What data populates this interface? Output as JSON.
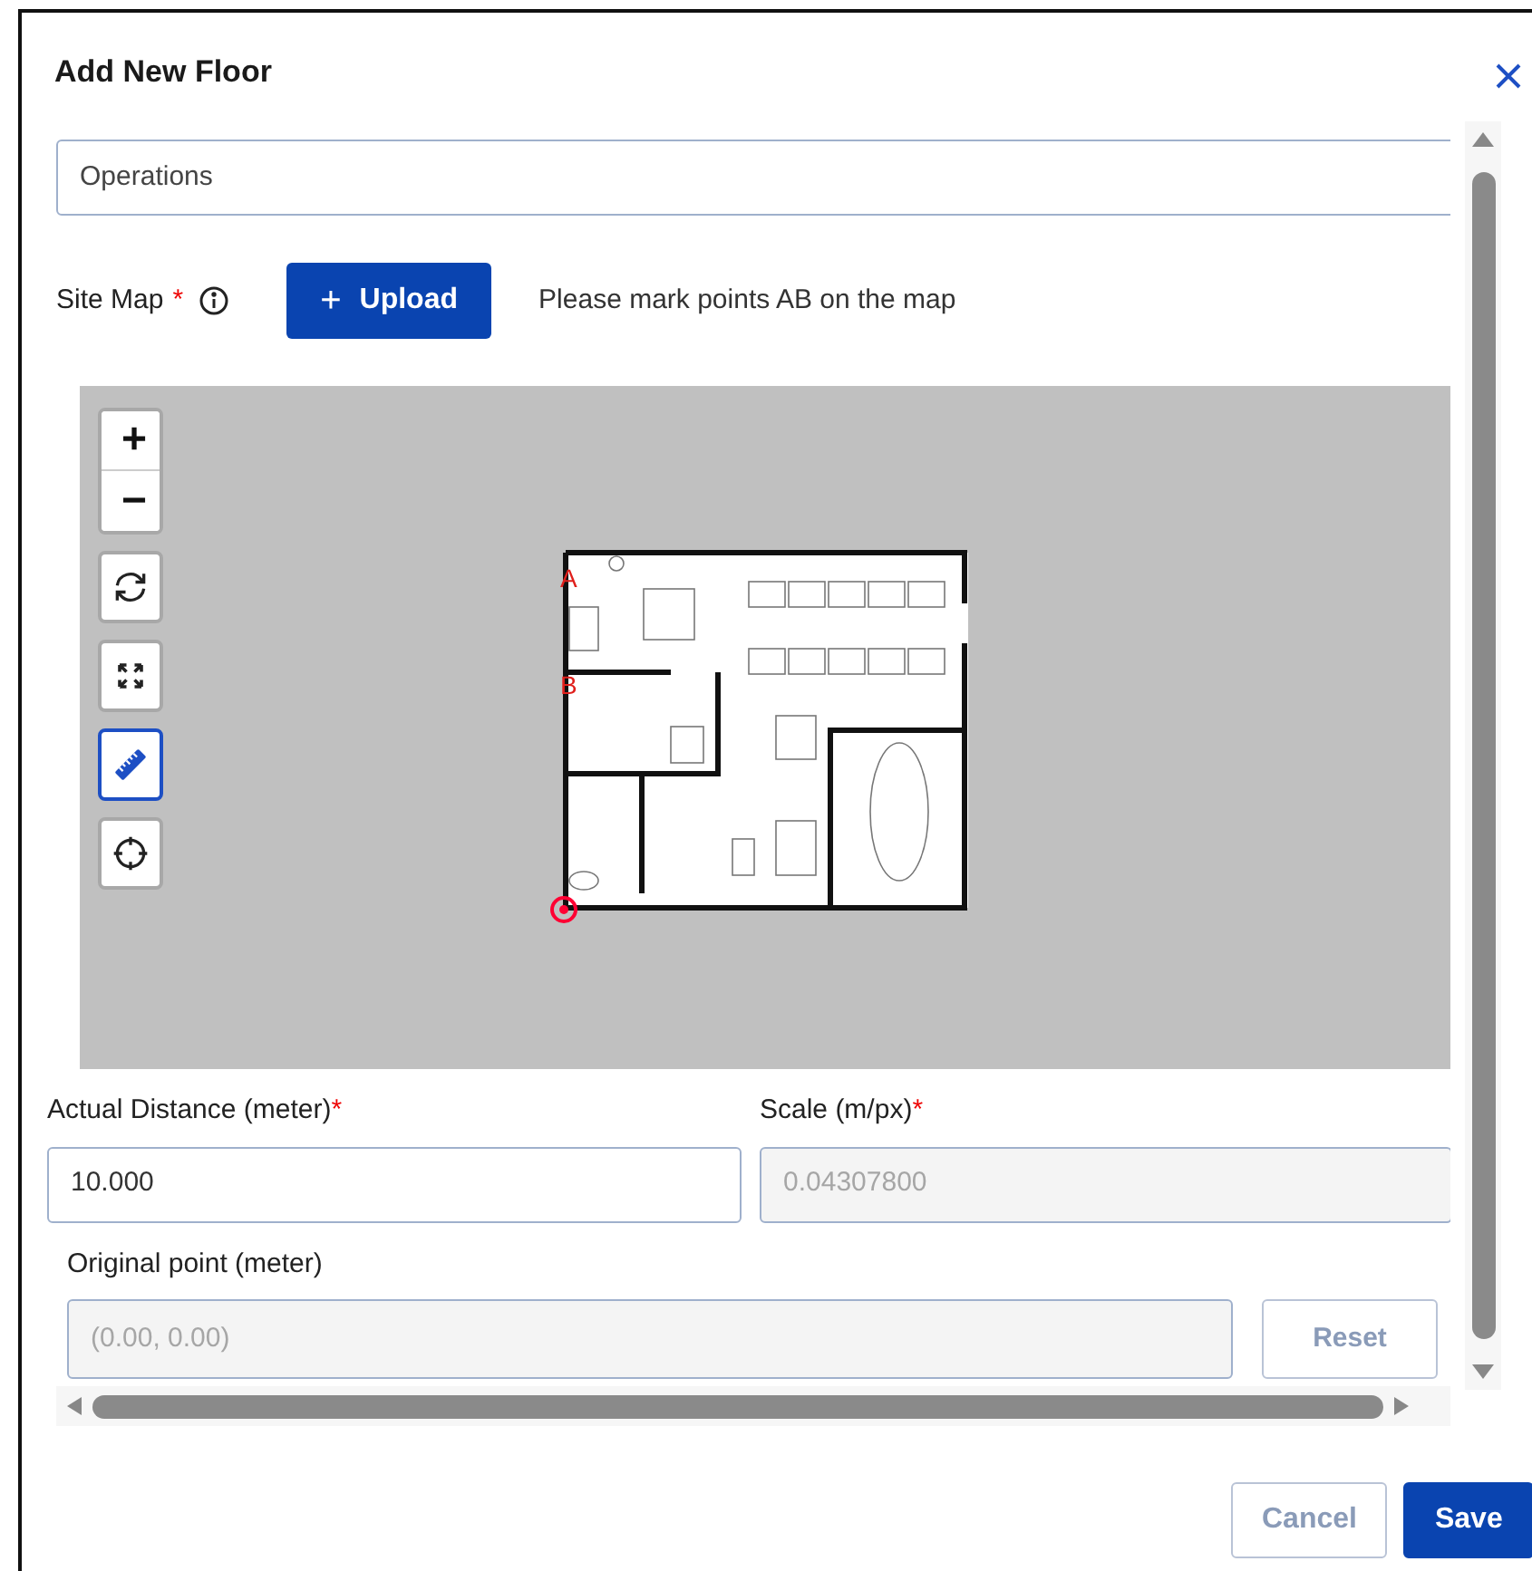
{
  "dialog": {
    "title": "Add New Floor"
  },
  "name_field": {
    "value": "Operations"
  },
  "site_map": {
    "label": "Site Map",
    "required_mark": "*",
    "upload_button": {
      "icon": "+",
      "label": "Upload"
    },
    "hint": "Please mark points AB on the map"
  },
  "map_tools": [
    {
      "kind": "zoom-in",
      "label": "+",
      "selected": false
    },
    {
      "kind": "zoom-out",
      "label": "−",
      "selected": false
    },
    {
      "kind": "rotate",
      "selected": false
    },
    {
      "kind": "fit",
      "selected": false
    },
    {
      "kind": "measure",
      "selected": true
    },
    {
      "kind": "origin",
      "selected": false
    }
  ],
  "map_points": [
    {
      "label": "A"
    },
    {
      "label": "B"
    }
  ],
  "actual_distance": {
    "label": "Actual Distance (meter)",
    "required_mark": "*",
    "value": "10.000"
  },
  "scale": {
    "label": "Scale (m/px)",
    "required_mark": "*",
    "value": "0.04307800",
    "disabled": true
  },
  "original_point": {
    "label": "Original point (meter)",
    "value": "(0.00, 0.00)",
    "disabled": true,
    "reset_button": "Reset"
  },
  "buttons": [
    {
      "label": "Cancel",
      "kind": "secondary"
    },
    {
      "label": "Save",
      "kind": "primary"
    }
  ]
}
